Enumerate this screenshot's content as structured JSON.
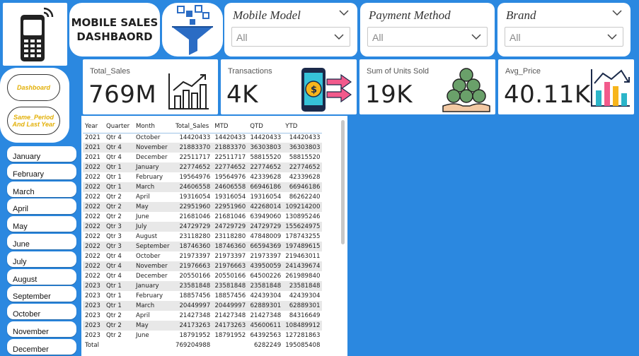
{
  "header": {
    "title_line1": "MOBILE SALES",
    "title_line2": "DASHBAORD"
  },
  "slicers": [
    {
      "title": "Mobile Model",
      "value": "All"
    },
    {
      "title": "Payment Method",
      "value": "All"
    },
    {
      "title": "Brand",
      "value": "All"
    }
  ],
  "nav": {
    "dashboard_label": "Dashboard",
    "same_period_label_line1": "Same_Period",
    "same_period_label_line2": "And Last Year"
  },
  "kpis": [
    {
      "label": "Total_Sales",
      "value": "769M",
      "icon": "bar-growth-icon"
    },
    {
      "label": "Transactions",
      "value": "4K",
      "icon": "payment-transfer-icon"
    },
    {
      "label": "Sum of Units Sold",
      "value": "19K",
      "icon": "money-bags-icon"
    },
    {
      "label": "Avg_Price",
      "value": "40.11K",
      "icon": "trend-chart-icon"
    }
  ],
  "months": [
    "January",
    "February",
    "March",
    "April",
    "May",
    "June",
    "July",
    "August",
    "September",
    "October",
    "November",
    "December"
  ],
  "table": {
    "columns": [
      "Year",
      "Quarter",
      "Month",
      "Total_Sales",
      "MTD",
      "QTD",
      "YTD"
    ],
    "rows": [
      [
        "2021",
        "Qtr 4",
        "October",
        "14420433",
        "14420433",
        "14420433",
        "14420433"
      ],
      [
        "2021",
        "Qtr 4",
        "November",
        "21883370",
        "21883370",
        "36303803",
        "36303803"
      ],
      [
        "2021",
        "Qtr 4",
        "December",
        "22511717",
        "22511717",
        "58815520",
        "58815520"
      ],
      [
        "2022",
        "Qtr 1",
        "January",
        "22774652",
        "22774652",
        "22774652",
        "22774652"
      ],
      [
        "2022",
        "Qtr 1",
        "February",
        "19564976",
        "19564976",
        "42339628",
        "42339628"
      ],
      [
        "2022",
        "Qtr 1",
        "March",
        "24606558",
        "24606558",
        "66946186",
        "66946186"
      ],
      [
        "2022",
        "Qtr 2",
        "April",
        "19316054",
        "19316054",
        "19316054",
        "86262240"
      ],
      [
        "2022",
        "Qtr 2",
        "May",
        "22951960",
        "22951960",
        "42268014",
        "109214200"
      ],
      [
        "2022",
        "Qtr 2",
        "June",
        "21681046",
        "21681046",
        "63949060",
        "130895246"
      ],
      [
        "2022",
        "Qtr 3",
        "July",
        "24729729",
        "24729729",
        "24729729",
        "155624975"
      ],
      [
        "2022",
        "Qtr 3",
        "August",
        "23118280",
        "23118280",
        "47848009",
        "178743255"
      ],
      [
        "2022",
        "Qtr 3",
        "September",
        "18746360",
        "18746360",
        "66594369",
        "197489615"
      ],
      [
        "2022",
        "Qtr 4",
        "October",
        "21973397",
        "21973397",
        "21973397",
        "219463011"
      ],
      [
        "2022",
        "Qtr 4",
        "November",
        "21976663",
        "21976663",
        "43950059",
        "241439674"
      ],
      [
        "2022",
        "Qtr 4",
        "December",
        "20550166",
        "20550166",
        "64500226",
        "261989840"
      ],
      [
        "2023",
        "Qtr 1",
        "January",
        "23581848",
        "23581848",
        "23581848",
        "23581848"
      ],
      [
        "2023",
        "Qtr 1",
        "February",
        "18857456",
        "18857456",
        "42439304",
        "42439304"
      ],
      [
        "2023",
        "Qtr 1",
        "March",
        "20449997",
        "20449997",
        "62889301",
        "62889301"
      ],
      [
        "2023",
        "Qtr 2",
        "April",
        "21427348",
        "21427348",
        "21427348",
        "84316649"
      ],
      [
        "2023",
        "Qtr 2",
        "May",
        "24173263",
        "24173263",
        "45600611",
        "108489912"
      ],
      [
        "2023",
        "Qtr 2",
        "June",
        "18791952",
        "18791952",
        "64392563",
        "127281863"
      ]
    ],
    "total": [
      "Total",
      "",
      "",
      "769204988",
      "",
      "6282249",
      "195085408"
    ]
  },
  "colors": {
    "background": "#2b88e0",
    "nav_text": "#e3b007",
    "table_alt_row": "#e8e8e8"
  }
}
